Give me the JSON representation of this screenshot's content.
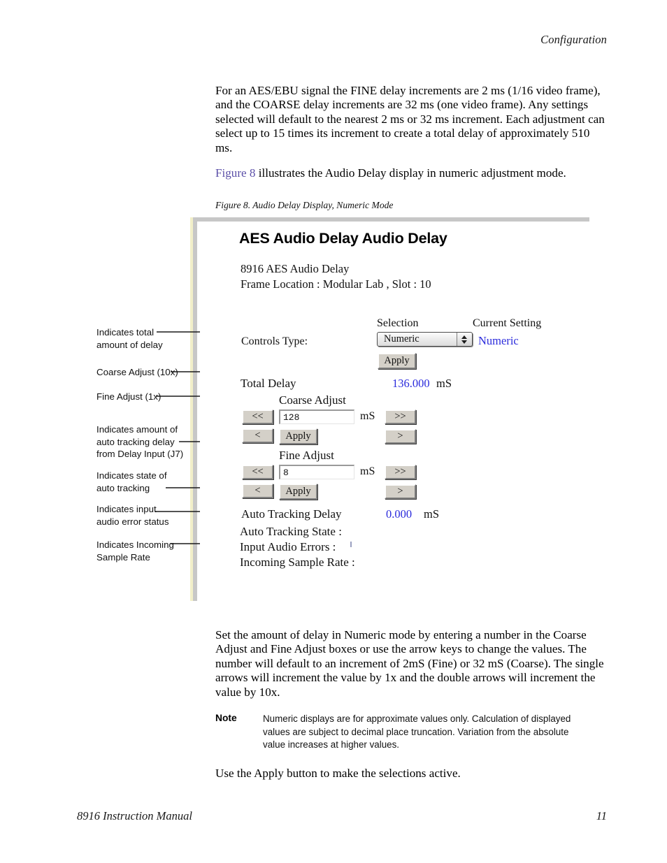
{
  "page": {
    "running_header": "Configuration",
    "footer_left": "8916 Instruction Manual",
    "footer_page_number": "11"
  },
  "body": {
    "paragraph_1": "For an AES/EBU signal the FINE delay increments are 2 ms (1/16 video frame), and the COARSE delay increments are 32 ms (one video frame). Any settings selected will default to the nearest 2 ms or 32 ms increment. Each adjustment can select up to 15 times its increment to create a total delay of approximately 510 ms.",
    "paragraph_2_xref": "Figure 8",
    "paragraph_2_rest": " illustrates the Audio Delay display in numeric adjustment mode.",
    "paragraph_3": "Set the amount of delay in Numeric mode by entering a number in the Coarse Adjust and Fine Adjust boxes or use the arrow keys to change the values. The number will default to an increment of 2mS (Fine) or 32 mS (Coarse). The single arrows will increment the value by 1x and the double arrows will increment the value by 10x.",
    "paragraph_4": "Use the Apply button to make the selections active."
  },
  "note": {
    "label": "Note",
    "text": "Numeric displays are for approximate values only. Calculation of displayed values are subject to decimal place truncation. Variation from the absolute value increases at higher values."
  },
  "figure": {
    "caption": "Figure 8.  Audio Delay Display, Numeric Mode"
  },
  "screenshot": {
    "title": "AES Audio Delay Audio Delay",
    "subtitle_line1": "8916 AES Audio Delay",
    "subtitle_line2": "Frame Location : Modular Lab , Slot : 10",
    "column_headers": {
      "selection": "Selection",
      "current_setting": "Current Setting"
    },
    "controls_type": {
      "label": "Controls Type:",
      "selected_option": "Numeric",
      "options": [
        "Numeric"
      ],
      "current_setting_value": "Numeric",
      "apply_label": "Apply"
    },
    "total_delay": {
      "label": "Total Delay",
      "value": "136.000",
      "unit": "mS"
    },
    "coarse_adjust": {
      "group_label": "Coarse Adjust",
      "value": "128",
      "unit": "mS",
      "decrement_x10_label": "<<",
      "decrement_x1_label": "<",
      "increment_x10_label": ">>",
      "increment_x1_label": ">",
      "apply_label": "Apply"
    },
    "fine_adjust": {
      "group_label": "Fine Adjust",
      "value": "8",
      "unit": "mS",
      "decrement_x10_label": "<<",
      "decrement_x1_label": "<",
      "increment_x10_label": ">>",
      "increment_x1_label": ">",
      "apply_label": "Apply"
    },
    "auto_tracking_delay": {
      "label": "Auto Tracking Delay",
      "value": "0.000",
      "unit": "mS"
    },
    "status_lines": {
      "auto_tracking_state": "Auto Tracking State :",
      "input_audio_errors": "Input Audio Errors :",
      "incoming_sample_rate": "Incoming Sample Rate :"
    }
  },
  "callouts": [
    {
      "id": "total-delay",
      "line1": "Indicates total",
      "line2": "amount of delay",
      "line3": ""
    },
    {
      "id": "coarse-adjust",
      "line1": "Coarse Adjust (10x)",
      "line2": "",
      "line3": ""
    },
    {
      "id": "fine-adjust",
      "line1": "Fine Adjust (1x)",
      "line2": "",
      "line3": ""
    },
    {
      "id": "auto-tracking-amt",
      "line1": "Indicates amount of",
      "line2": "auto tracking delay",
      "line3": "from Delay Input (J7)"
    },
    {
      "id": "auto-tracking-state",
      "line1": "Indicates state of",
      "line2": "auto tracking",
      "line3": ""
    },
    {
      "id": "input-audio-errors",
      "line1": "Indicates input",
      "line2": "audio error status",
      "line3": ""
    },
    {
      "id": "incoming-rate",
      "line1": "Indicates Incoming",
      "line2": "Sample Rate",
      "line3": ""
    }
  ],
  "colors": {
    "link": "#5b4fa8",
    "value_blue": "#2b2bdc",
    "frame_gray": "#c7c7c7",
    "frame_cream": "#f2efc9",
    "button_face": "#d4d0c8"
  }
}
